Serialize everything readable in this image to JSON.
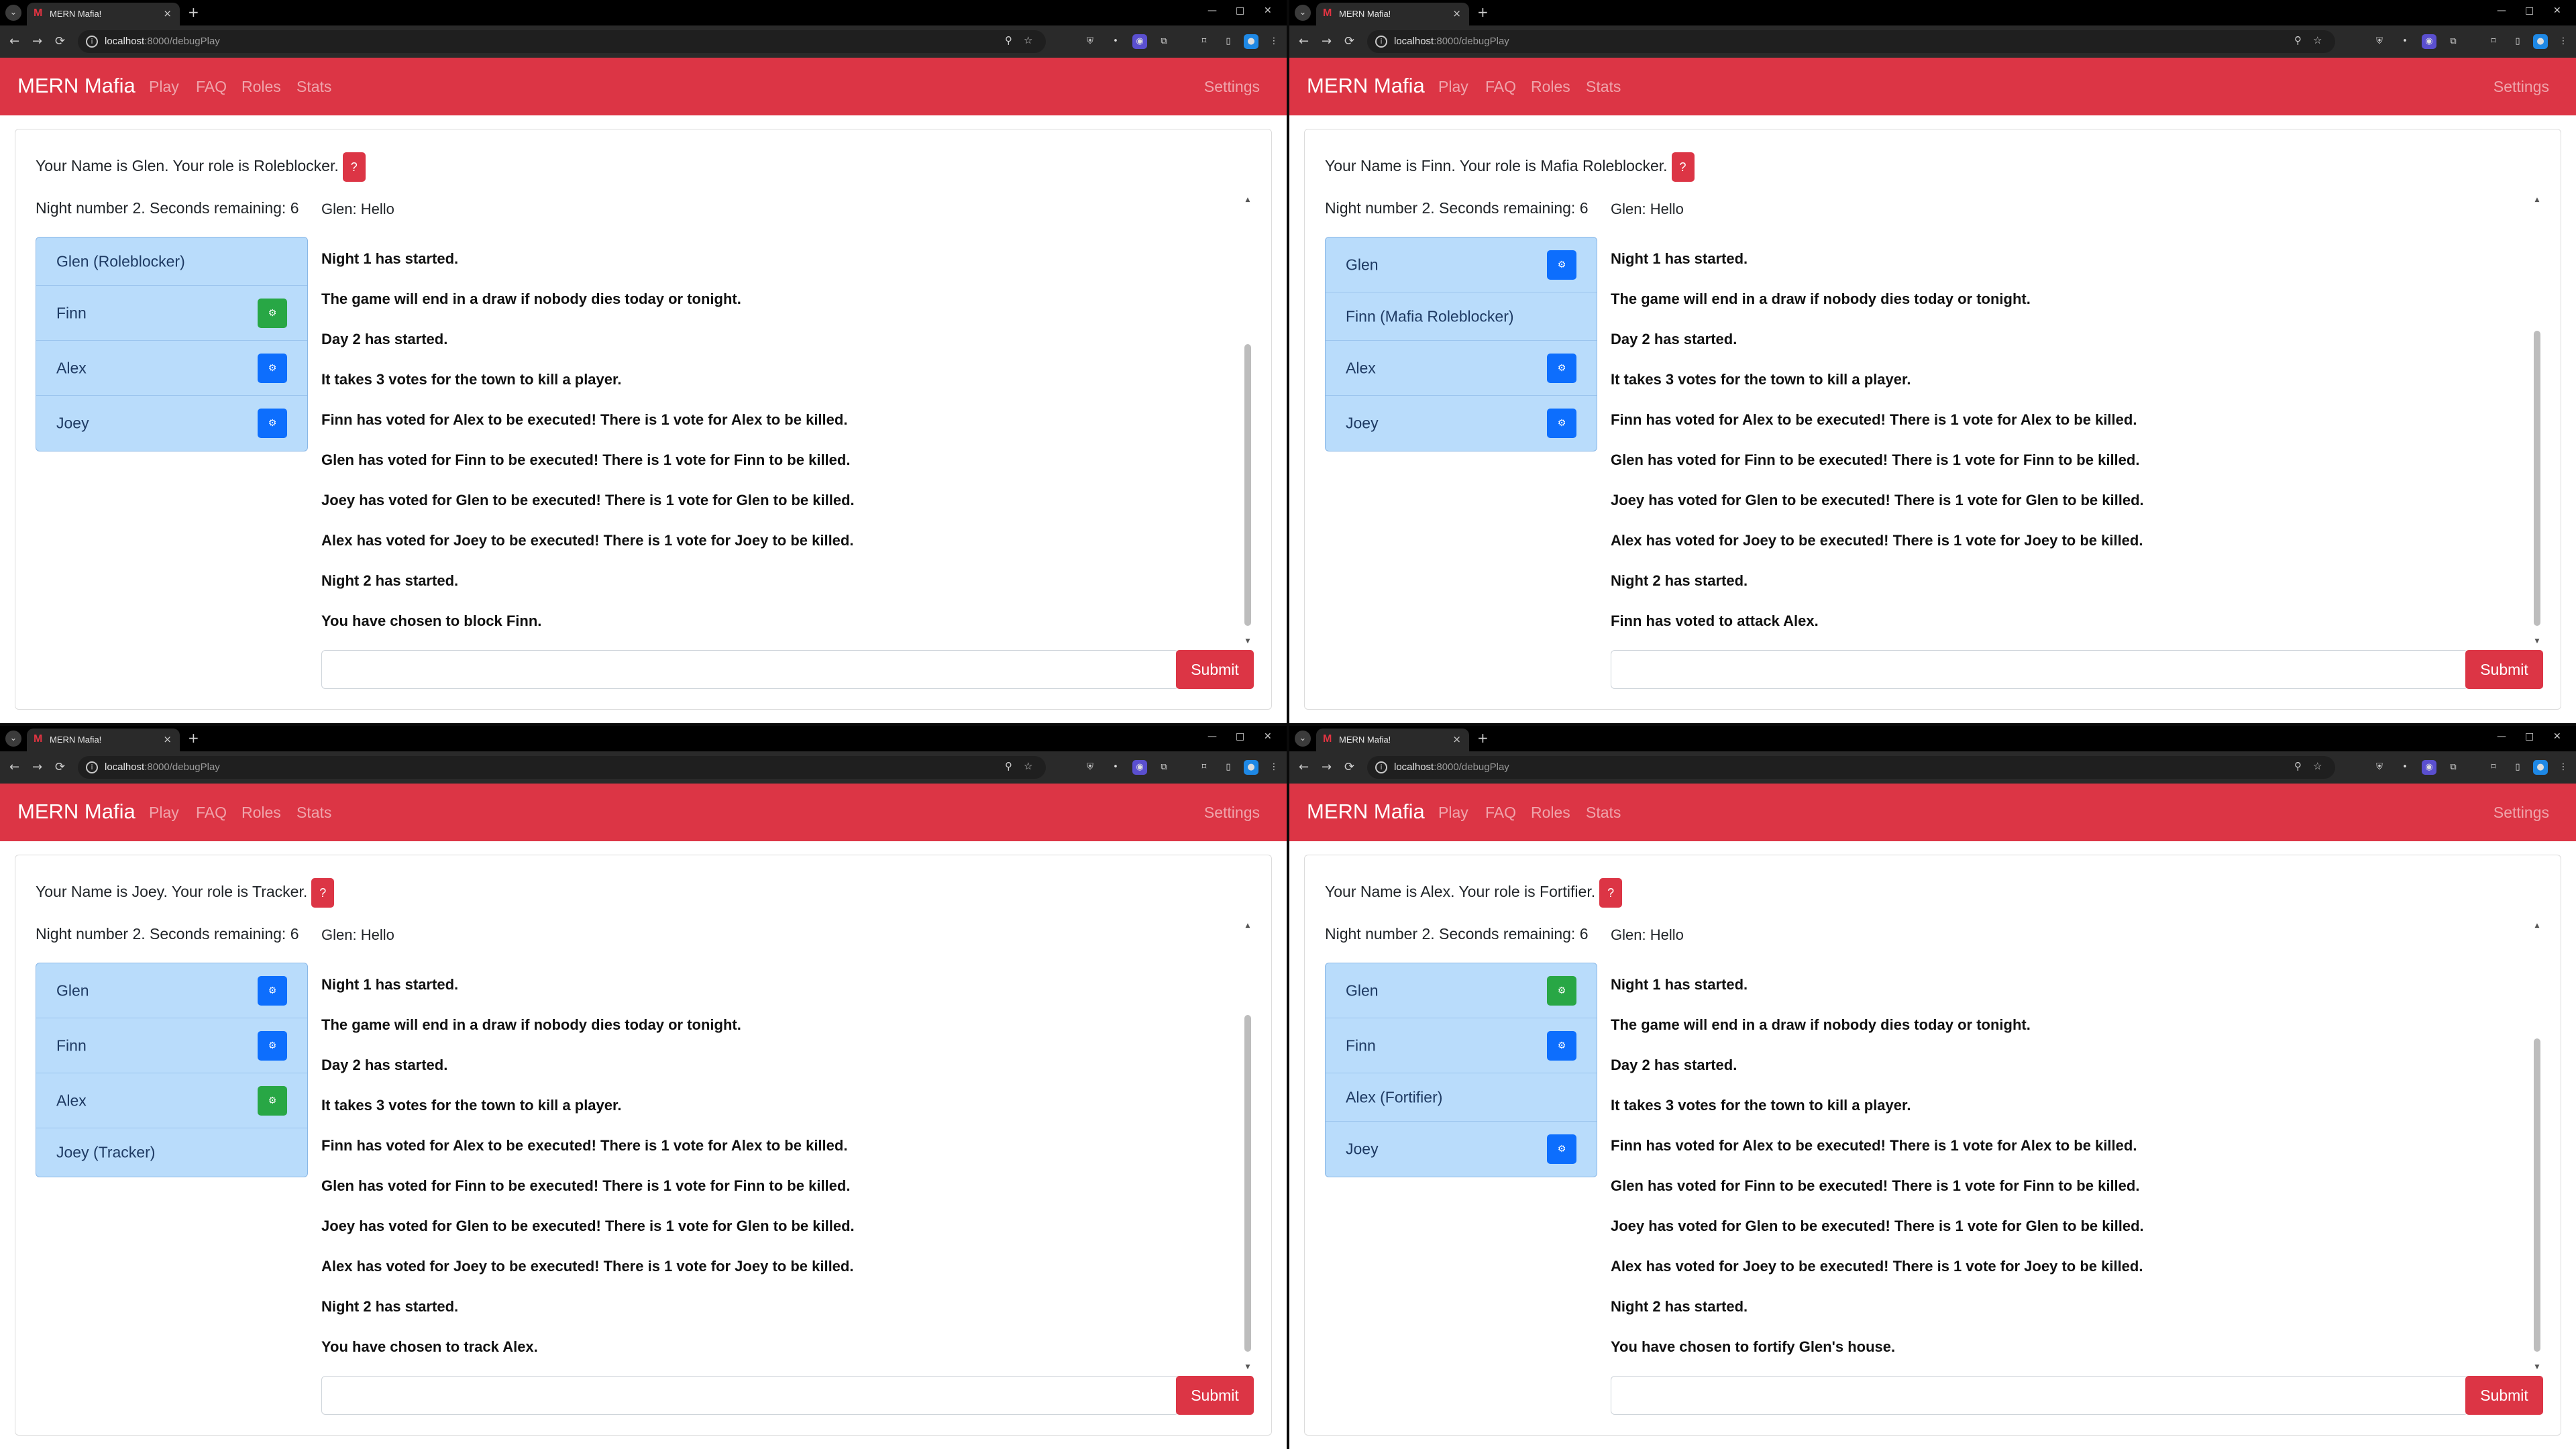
{
  "browser": {
    "tab_title": "MERN Mafia!",
    "favicon_letter": "M",
    "url_host": "localhost",
    "url_path": ":8000/debugPlay",
    "icons": [
      "search-icon",
      "star-icon",
      "shield-extension-icon",
      "dot-extension-icon",
      "profile-icon",
      "puzzle-extension-icon",
      "sidebar-icon",
      "menu-icon"
    ]
  },
  "site": {
    "brand": "MERN Mafia",
    "nav": [
      "Play",
      "FAQ",
      "Roles",
      "Stats"
    ],
    "settings": "Settings",
    "accent_color": "#dc3545",
    "submit_label": "Submit",
    "help_label": "?"
  },
  "windows": [
    {
      "role_text": "Your Name is Glen. Your role is Roleblocker.",
      "night_text": "Night number 2. Seconds remaining: 6",
      "players": [
        {
          "name": "Glen (Roleblocker)",
          "button": null
        },
        {
          "name": "Finn",
          "button": "green"
        },
        {
          "name": "Alex",
          "button": "blue"
        },
        {
          "name": "Joey",
          "button": "blue"
        }
      ],
      "messages": [
        {
          "text": "Glen: Hello",
          "bold": false
        },
        {
          "text": "Night 1 has started.",
          "bold": true
        },
        {
          "text": "The game will end in a draw if nobody dies today or tonight.",
          "bold": true
        },
        {
          "text": "Day 2 has started.",
          "bold": true
        },
        {
          "text": "It takes 3 votes for the town to kill a player.",
          "bold": true
        },
        {
          "text": "Finn has voted for Alex to be executed! There is 1 vote for Alex to be killed.",
          "bold": true
        },
        {
          "text": "Glen has voted for Finn to be executed! There is 1 vote for Finn to be killed.",
          "bold": true
        },
        {
          "text": "Joey has voted for Glen to be executed! There is 1 vote for Glen to be killed.",
          "bold": true
        },
        {
          "text": "Alex has voted for Joey to be executed! There is 1 vote for Joey to be killed.",
          "bold": true
        },
        {
          "text": "Night 2 has started.",
          "bold": true
        },
        {
          "text": "You have chosen to block Finn.",
          "bold": true
        }
      ]
    },
    {
      "role_text": "Your Name is Finn. Your role is Mafia Roleblocker.",
      "night_text": "Night number 2. Seconds remaining: 6",
      "players": [
        {
          "name": "Glen",
          "button": "blue"
        },
        {
          "name": "Finn (Mafia Roleblocker)",
          "button": null
        },
        {
          "name": "Alex",
          "button": "blue"
        },
        {
          "name": "Joey",
          "button": "blue"
        }
      ],
      "messages": [
        {
          "text": "Glen: Hello",
          "bold": false
        },
        {
          "text": "Night 1 has started.",
          "bold": true
        },
        {
          "text": "The game will end in a draw if nobody dies today or tonight.",
          "bold": true
        },
        {
          "text": "Day 2 has started.",
          "bold": true
        },
        {
          "text": "It takes 3 votes for the town to kill a player.",
          "bold": true
        },
        {
          "text": "Finn has voted for Alex to be executed! There is 1 vote for Alex to be killed.",
          "bold": true
        },
        {
          "text": "Glen has voted for Finn to be executed! There is 1 vote for Finn to be killed.",
          "bold": true
        },
        {
          "text": "Joey has voted for Glen to be executed! There is 1 vote for Glen to be killed.",
          "bold": true
        },
        {
          "text": "Alex has voted for Joey to be executed! There is 1 vote for Joey to be killed.",
          "bold": true
        },
        {
          "text": "Night 2 has started.",
          "bold": true
        },
        {
          "text": "Finn has voted to attack Alex.",
          "bold": true
        }
      ]
    },
    {
      "role_text": "Your Name is Joey. Your role is Tracker.",
      "night_text": "Night number 2. Seconds remaining: 6",
      "players": [
        {
          "name": "Glen",
          "button": "blue"
        },
        {
          "name": "Finn",
          "button": "blue"
        },
        {
          "name": "Alex",
          "button": "green"
        },
        {
          "name": "Joey (Tracker)",
          "button": null
        }
      ],
      "messages": [
        {
          "text": "Glen: Hello",
          "bold": false
        },
        {
          "text": "Night 1 has started.",
          "bold": true
        },
        {
          "text": "The game will end in a draw if nobody dies today or tonight.",
          "bold": true
        },
        {
          "text": "Day 2 has started.",
          "bold": true
        },
        {
          "text": "It takes 3 votes for the town to kill a player.",
          "bold": true
        },
        {
          "text": "Finn has voted for Alex to be executed! There is 1 vote for Alex to be killed.",
          "bold": true
        },
        {
          "text": "Glen has voted for Finn to be executed! There is 1 vote for Finn to be killed.",
          "bold": true
        },
        {
          "text": "Joey has voted for Glen to be executed! There is 1 vote for Glen to be killed.",
          "bold": true
        },
        {
          "text": "Alex has voted for Joey to be executed! There is 1 vote for Joey to be killed.",
          "bold": true
        },
        {
          "text": "Night 2 has started.",
          "bold": true
        },
        {
          "text": "You have chosen to track Alex.",
          "bold": true
        }
      ]
    },
    {
      "role_text": "Your Name is Alex. Your role is Fortifier.",
      "night_text": "Night number 2. Seconds remaining: 6",
      "players": [
        {
          "name": "Glen",
          "button": "green"
        },
        {
          "name": "Finn",
          "button": "blue"
        },
        {
          "name": "Alex (Fortifier)",
          "button": null
        },
        {
          "name": "Joey",
          "button": "blue"
        }
      ],
      "messages": [
        {
          "text": "Glen: Hello",
          "bold": false
        },
        {
          "text": "Night 1 has started.",
          "bold": true
        },
        {
          "text": "The game will end in a draw if nobody dies today or tonight.",
          "bold": true
        },
        {
          "text": "Day 2 has started.",
          "bold": true
        },
        {
          "text": "It takes 3 votes for the town to kill a player.",
          "bold": true
        },
        {
          "text": "Finn has voted for Alex to be executed! There is 1 vote for Alex to be killed.",
          "bold": true
        },
        {
          "text": "Glen has voted for Finn to be executed! There is 1 vote for Finn to be killed.",
          "bold": true
        },
        {
          "text": "Joey has voted for Glen to be executed! There is 1 vote for Glen to be killed.",
          "bold": true
        },
        {
          "text": "Alex has voted for Joey to be executed! There is 1 vote for Joey to be killed.",
          "bold": true
        },
        {
          "text": "Night 2 has started.",
          "bold": true
        },
        {
          "text": "You have chosen to fortify Glen's house.",
          "bold": true
        }
      ]
    }
  ]
}
